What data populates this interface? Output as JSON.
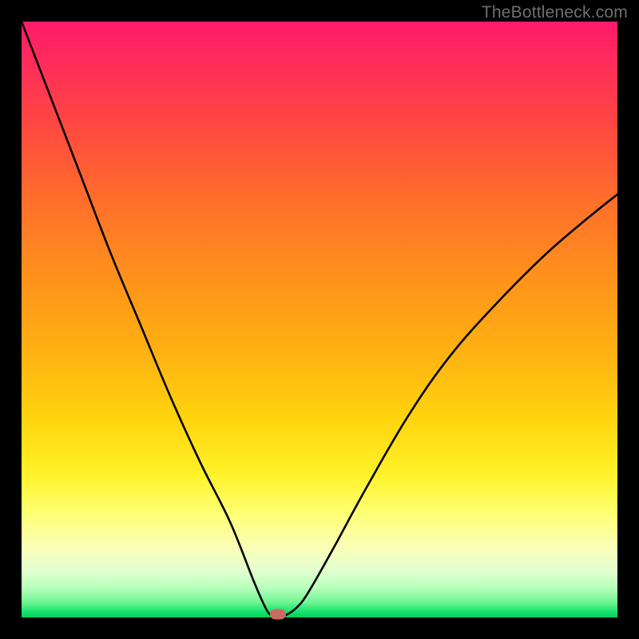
{
  "watermark": {
    "text": "TheBottleneck.com"
  },
  "chart_data": {
    "type": "line",
    "title": "",
    "xlabel": "",
    "ylabel": "",
    "xlim": [
      0,
      100
    ],
    "ylim": [
      0,
      100
    ],
    "grid": false,
    "series": [
      {
        "name": "bottleneck-curve",
        "x": [
          0,
          5,
          10,
          15,
          20,
          25,
          30,
          35,
          39,
          41,
          42,
          43,
          44,
          46,
          48,
          52,
          58,
          65,
          72,
          80,
          88,
          95,
          100
        ],
        "y": [
          100,
          87,
          74,
          61,
          49,
          37,
          26,
          16,
          6,
          1.5,
          0.3,
          0,
          0.2,
          1.5,
          4,
          11,
          22,
          34,
          44,
          53,
          61,
          67,
          71
        ]
      }
    ],
    "marker": {
      "x": 43,
      "y": 0.6,
      "color": "#cb6a62"
    },
    "background_gradient": {
      "direction": "top-to-bottom",
      "stops": [
        {
          "pos": 0,
          "color": "#ff1a6a"
        },
        {
          "pos": 18,
          "color": "#ff4a3f"
        },
        {
          "pos": 42,
          "color": "#ff8f1c"
        },
        {
          "pos": 67,
          "color": "#ffd50e"
        },
        {
          "pos": 82,
          "color": "#ffff6e"
        },
        {
          "pos": 95,
          "color": "#b9ffbd"
        },
        {
          "pos": 100,
          "color": "#00d25e"
        }
      ]
    }
  }
}
